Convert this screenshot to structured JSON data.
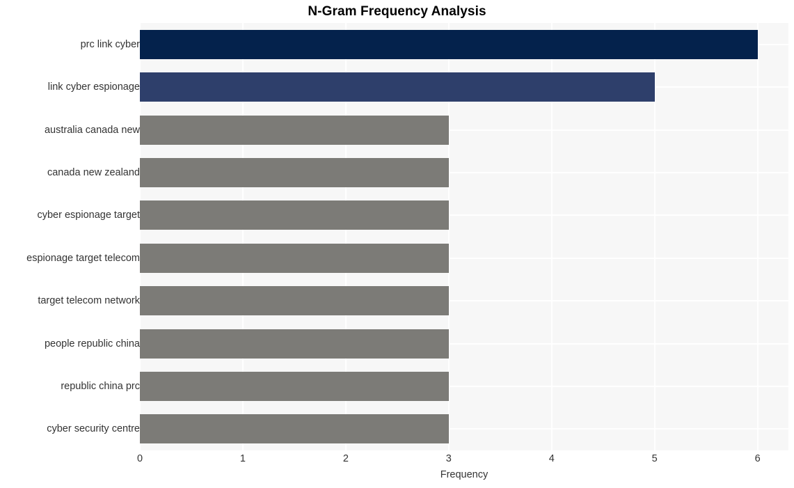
{
  "chart_data": {
    "type": "bar",
    "orientation": "horizontal",
    "title": "N-Gram Frequency Analysis",
    "xlabel": "Frequency",
    "ylabel": "",
    "categories": [
      "prc link cyber",
      "link cyber espionage",
      "australia canada new",
      "canada new zealand",
      "cyber espionage target",
      "espionage target telecom",
      "target telecom network",
      "people republic china",
      "republic china prc",
      "cyber security centre"
    ],
    "values": [
      6,
      5,
      3,
      3,
      3,
      3,
      3,
      3,
      3,
      3
    ],
    "bar_colors": [
      "#04224c",
      "#2e3f6b",
      "#7c7b77",
      "#7c7b77",
      "#7c7b77",
      "#7c7b77",
      "#7c7b77",
      "#7c7b77",
      "#7c7b77",
      "#7c7b77"
    ],
    "xlim": [
      0,
      6.3
    ],
    "xticks": [
      0,
      1,
      2,
      3,
      4,
      5,
      6
    ],
    "xtick_labels": [
      "0",
      "1",
      "2",
      "3",
      "4",
      "5",
      "6"
    ],
    "grid": true,
    "grid_color": "#ffffff",
    "plot_background": "#f7f7f7",
    "figure_background": "#ffffff",
    "legend": null
  },
  "colors": {
    "title_text": "#000000",
    "tick_text": "#333333",
    "accent_primary": "#04224c",
    "accent_secondary": "#2e3f6b",
    "neutral": "#7c7b77"
  }
}
